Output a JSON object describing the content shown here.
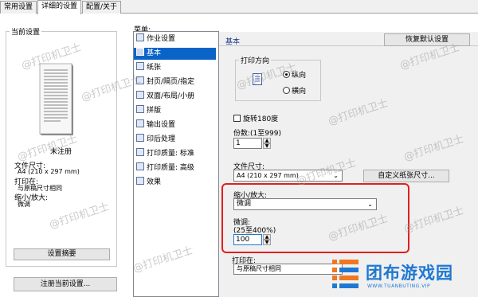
{
  "tabs": [
    "常用设置",
    "详细的设置",
    "配置/关于"
  ],
  "current_settings": {
    "title": "当前设置",
    "status": "未注册",
    "doc_size_label": "文件尺寸:",
    "doc_size_value": "A4 (210 x 297 mm)",
    "print_on_label": "打印在:",
    "print_on_value": "与原稿尺寸相同",
    "zoom_label": "缩小/放大:",
    "zoom_value": "微调",
    "preview_button": "设置摘要",
    "register_button": "注册当前设置..."
  },
  "menu": {
    "label": "菜单:",
    "items": [
      {
        "label": "作业设置",
        "icon": "job-settings-icon"
      },
      {
        "label": "基本",
        "icon": "basic-icon"
      },
      {
        "label": "纸张",
        "icon": "paper-icon"
      },
      {
        "label": "封页/隔页/指定",
        "icon": "cover-page-icon"
      },
      {
        "label": "双面/布局/小册",
        "icon": "duplex-layout-icon"
      },
      {
        "label": "拼版",
        "icon": "imposition-icon"
      },
      {
        "label": "输出设置",
        "icon": "output-settings-icon"
      },
      {
        "label": "印后处理",
        "icon": "finishing-icon"
      },
      {
        "label": "打印质量: 标准",
        "icon": "print-quality-standard-icon"
      },
      {
        "label": "打印质量: 高级",
        "icon": "print-quality-advanced-icon"
      },
      {
        "label": "效果",
        "icon": "effects-icon"
      }
    ],
    "selected_index": 1
  },
  "basic": {
    "header": "基本",
    "restore_button": "恢复默认设置",
    "orientation_title": "打印方向",
    "orientation_portrait": "纵向",
    "orientation_landscape": "横向",
    "rotate_label": "旋转180度",
    "copies_label": "份数:(1至999)",
    "copies_value": "1",
    "doc_size_label": "文件尺寸:",
    "doc_size_value": "A4 (210 x 297 mm)",
    "custom_paper_button": "自定义纸张尺寸...",
    "zoom_label": "缩小/放大:",
    "zoom_value": "微调",
    "fine_tune_label": "微调:",
    "fine_tune_range": "(25至400%)",
    "fine_tune_value": "100",
    "print_on_label": "打印在:",
    "print_on_value": "与原稿尺寸相同"
  },
  "watermark": {
    "text": "@打印机卫士",
    "brand": "团布游戏园",
    "brand_url": "WWW.TUANBUTING.VIP"
  },
  "colors": {
    "highlight_border": "#e02020",
    "selection": "#0a64c8",
    "brand_orange": "#f07820",
    "brand_blue": "#1e78d2"
  }
}
